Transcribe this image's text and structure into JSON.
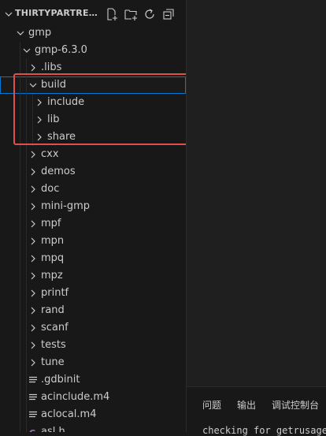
{
  "explorer": {
    "title": "THIRTYPARTRESTO...",
    "actions": [
      "new-file-icon",
      "new-folder-icon",
      "refresh-icon",
      "collapse-all-icon"
    ],
    "rows": [
      {
        "label": "gmp",
        "kind": "folder",
        "expanded": true,
        "depth": 0
      },
      {
        "label": "gmp-6.3.0",
        "kind": "folder",
        "expanded": true,
        "depth": 1
      },
      {
        "label": ".libs",
        "kind": "folder",
        "expanded": false,
        "depth": 2
      },
      {
        "label": "build",
        "kind": "folder",
        "expanded": true,
        "depth": 2,
        "selected": true
      },
      {
        "label": "include",
        "kind": "folder",
        "expanded": false,
        "depth": 3
      },
      {
        "label": "lib",
        "kind": "folder",
        "expanded": false,
        "depth": 3
      },
      {
        "label": "share",
        "kind": "folder",
        "expanded": false,
        "depth": 3
      },
      {
        "label": "cxx",
        "kind": "folder",
        "expanded": false,
        "depth": 2
      },
      {
        "label": "demos",
        "kind": "folder",
        "expanded": false,
        "depth": 2
      },
      {
        "label": "doc",
        "kind": "folder",
        "expanded": false,
        "depth": 2
      },
      {
        "label": "mini-gmp",
        "kind": "folder",
        "expanded": false,
        "depth": 2
      },
      {
        "label": "mpf",
        "kind": "folder",
        "expanded": false,
        "depth": 2
      },
      {
        "label": "mpn",
        "kind": "folder",
        "expanded": false,
        "depth": 2
      },
      {
        "label": "mpq",
        "kind": "folder",
        "expanded": false,
        "depth": 2
      },
      {
        "label": "mpz",
        "kind": "folder",
        "expanded": false,
        "depth": 2
      },
      {
        "label": "printf",
        "kind": "folder",
        "expanded": false,
        "depth": 2
      },
      {
        "label": "rand",
        "kind": "folder",
        "expanded": false,
        "depth": 2
      },
      {
        "label": "scanf",
        "kind": "folder",
        "expanded": false,
        "depth": 2
      },
      {
        "label": "tests",
        "kind": "folder",
        "expanded": false,
        "depth": 2
      },
      {
        "label": "tune",
        "kind": "folder",
        "expanded": false,
        "depth": 2
      },
      {
        "label": ".gdbinit",
        "kind": "file",
        "icon": "lines-file-icon",
        "depth": 2
      },
      {
        "label": "acinclude.m4",
        "kind": "file",
        "icon": "lines-file-icon",
        "depth": 2
      },
      {
        "label": "aclocal.m4",
        "kind": "file",
        "icon": "lines-file-icon",
        "depth": 2
      },
      {
        "label": "asl.h",
        "kind": "file",
        "icon": "c-header-icon",
        "depth": 2
      }
    ]
  },
  "panel": {
    "tabs": [
      "问题",
      "输出",
      "调试控制台"
    ],
    "terminal_text": "checking for getrusage"
  },
  "colors": {
    "sidebar_bg": "#181818",
    "editor_bg": "#1f1f1f",
    "text": "#cccccc",
    "selection_outline": "#0078d4",
    "annotation_red": "#e0504a",
    "c_header_purple": "#a074c4"
  }
}
